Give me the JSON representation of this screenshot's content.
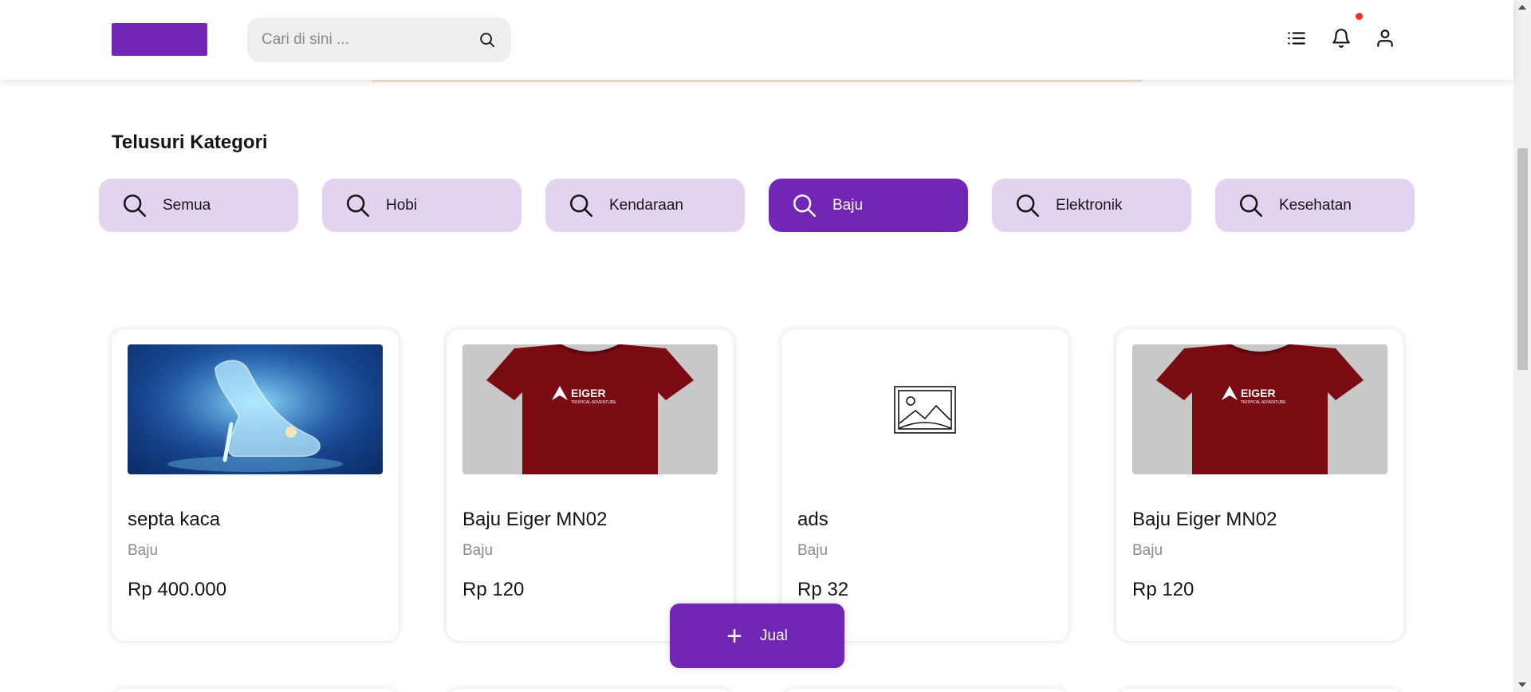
{
  "header": {
    "search_placeholder": "Cari di sini ...",
    "icons": [
      "list-icon",
      "bell-icon",
      "user-icon"
    ]
  },
  "categories": {
    "title": "Telusuri Kategori",
    "items": [
      {
        "label": "Semua",
        "active": false
      },
      {
        "label": "Hobi",
        "active": false
      },
      {
        "label": "Kendaraan",
        "active": false
      },
      {
        "label": "Baju",
        "active": true
      },
      {
        "label": "Elektronik",
        "active": false
      },
      {
        "label": "Kesehatan",
        "active": false
      }
    ]
  },
  "products": [
    {
      "name": "septa kaca",
      "category": "Baju",
      "price": "Rp 400.000",
      "image": "glass-slipper"
    },
    {
      "name": "Baju Eiger MN02",
      "category": "Baju",
      "price": "Rp 120",
      "image": "eiger-shirt"
    },
    {
      "name": "ads",
      "category": "Baju",
      "price": "Rp 32",
      "image": "placeholder"
    },
    {
      "name": "Baju Eiger MN02",
      "category": "Baju",
      "price": "Rp 120",
      "image": "eiger-shirt"
    }
  ],
  "shirt_logo": {
    "brand": "EIGER",
    "tagline": "TROPICAL ADVENTURE"
  },
  "sell_button": {
    "label": "Jual"
  },
  "colors": {
    "primary": "#7126b5",
    "primary_light": "#e2d4f0",
    "notification": "#fa2c2c",
    "shirt": "#7a0b12"
  }
}
